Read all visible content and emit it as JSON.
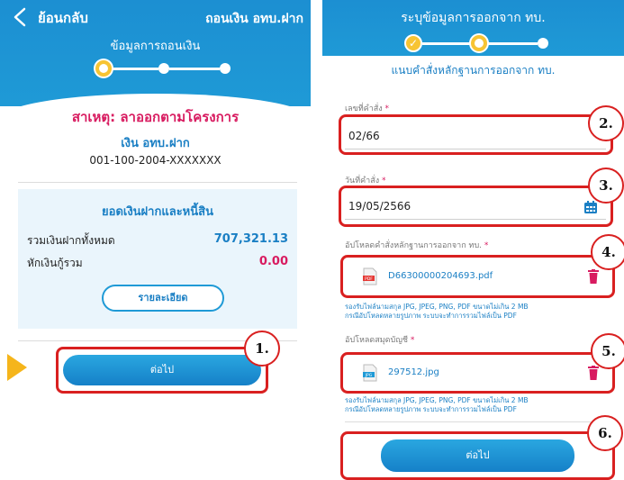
{
  "left_screen": {
    "back_label": "ย้อนกลับ",
    "menu_title": "ถอนเงิน อทบ.ฝาก",
    "subtitle": "ข้อมูลการถอนเงิน",
    "cause": "สาเหตุ: ลาออกตามโครงการ",
    "account_type": "เงิน อทบ.ฝาก",
    "account_number": "001-100-2004-XXXXXXX",
    "balance": {
      "title": "ยอดเงินฝากและหนี้สิน",
      "total_deposit_label": "รวมเงินฝากทั้งหมด",
      "total_deposit_value": "707,321.13",
      "loan_deduction_label": "หักเงินกู้รวม",
      "loan_deduction_value": "0.00",
      "detail_button": "รายละเอียด"
    },
    "next_button": "ต่อไป",
    "marker": "1.",
    "colors": {
      "deposit_value": "#1a7fc4",
      "loan_value": "#d81b60"
    }
  },
  "right_screen": {
    "title": "ระบุข้อมูลการออกจาก ทบ.",
    "form_title": "แนบคำสั่งหลักฐานการออกจาก ทบ.",
    "order_no": {
      "label": "เลขที่คำสั่ง",
      "required": "*",
      "value": "02/66"
    },
    "order_date": {
      "label": "วันที่คำสั่ง",
      "required": "*",
      "value": "19/05/2566"
    },
    "upload_order": {
      "label": "อัปโหลดคำสั่งหลักฐานการออกจาก ทบ.",
      "required": "*",
      "file_name": "D66300000204693.pdf",
      "file_icon": "pdf-file-icon"
    },
    "upload_book": {
      "label": "อัปโหลดสมุดบัญชี",
      "required": "*",
      "file_name": "297512.jpg",
      "file_icon": "image-file-icon"
    },
    "hint_line1": "รองรับไฟล์นามสกุล JPG, JPEG, PNG, PDF ขนาดไม่เกิน 2 MB",
    "hint_line2": "กรณีอัปโหลดหลายรูปภาพ ระบบจะทำการรวมไฟล์เป็น PDF",
    "next_button": "ต่อไป",
    "markers": [
      "2.",
      "3.",
      "4.",
      "5.",
      "6."
    ]
  }
}
